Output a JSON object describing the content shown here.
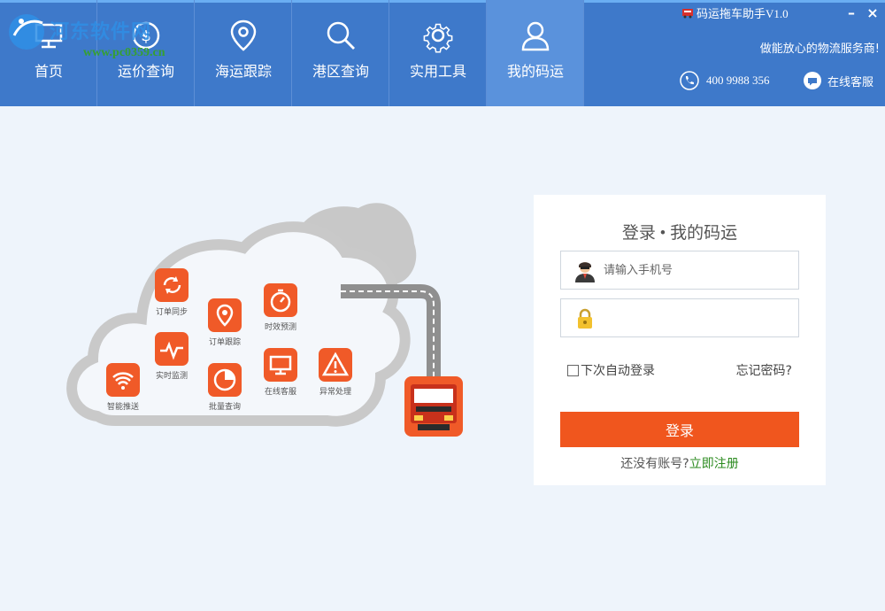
{
  "nav": {
    "items": [
      {
        "label": "首页"
      },
      {
        "label": "运价查询"
      },
      {
        "label": "海运跟踪"
      },
      {
        "label": "港区查询"
      },
      {
        "label": "实用工具"
      },
      {
        "label": "我的码运"
      }
    ]
  },
  "watermark": {
    "text": "河东软件网",
    "url": "www.pc0359.cn"
  },
  "header": {
    "app_title": "码运拖车助手V1.0",
    "minimize": "–",
    "close": "×",
    "tagline": "做能放心的物流服务商!",
    "phone": "400 9988 356",
    "service": "在线客服"
  },
  "features": [
    {
      "label": "订单同步",
      "icon": "sync-icon"
    },
    {
      "label": "订单跟踪",
      "icon": "location-icon"
    },
    {
      "label": "时效预测",
      "icon": "timer-icon"
    },
    {
      "label": "实时监测",
      "icon": "pulse-icon"
    },
    {
      "label": "智能推送",
      "icon": "wifi-icon"
    },
    {
      "label": "批量查询",
      "icon": "pie-icon"
    },
    {
      "label": "在线客服",
      "icon": "monitor-icon"
    },
    {
      "label": "异常处理",
      "icon": "warning-icon"
    }
  ],
  "login": {
    "title": "登录 • 我的码运",
    "phone_placeholder": "请输入手机号",
    "password_placeholder": "",
    "remember": "下次自动登录",
    "forgot": "忘记密码?",
    "button": "登录",
    "no_account": "还没有账号?",
    "register": "立即注册"
  },
  "colors": {
    "accent": "#f0561e",
    "header": "#3e79ca",
    "link": "#2a8a1e"
  }
}
